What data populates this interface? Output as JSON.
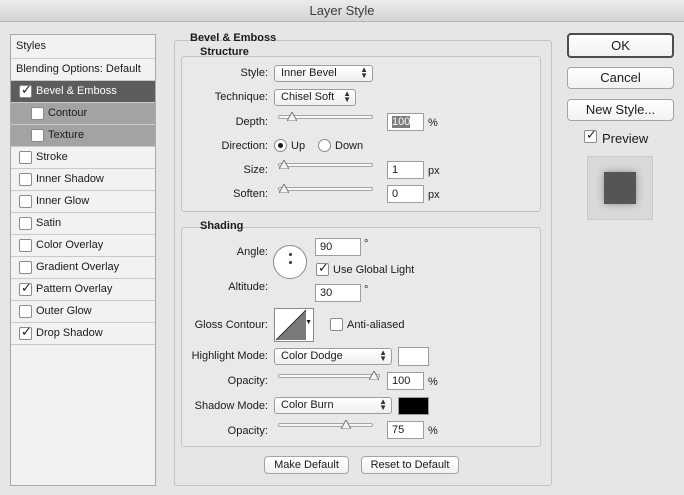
{
  "window": {
    "title": "Layer Style"
  },
  "left_list": {
    "header": "Styles",
    "items": [
      {
        "label": "Blending Options: Default",
        "checkbox": false,
        "checked": false,
        "state": "normal"
      },
      {
        "label": "Bevel & Emboss",
        "checkbox": true,
        "checked": true,
        "state": "selected"
      },
      {
        "label": "Contour",
        "checkbox": true,
        "checked": false,
        "state": "sub"
      },
      {
        "label": "Texture",
        "checkbox": true,
        "checked": false,
        "state": "sub"
      },
      {
        "label": "Stroke",
        "checkbox": true,
        "checked": false,
        "state": "normal"
      },
      {
        "label": "Inner Shadow",
        "checkbox": true,
        "checked": false,
        "state": "normal"
      },
      {
        "label": "Inner Glow",
        "checkbox": true,
        "checked": false,
        "state": "normal"
      },
      {
        "label": "Satin",
        "checkbox": true,
        "checked": false,
        "state": "normal"
      },
      {
        "label": "Color Overlay",
        "checkbox": true,
        "checked": false,
        "state": "normal"
      },
      {
        "label": "Gradient Overlay",
        "checkbox": true,
        "checked": false,
        "state": "normal"
      },
      {
        "label": "Pattern Overlay",
        "checkbox": true,
        "checked": true,
        "state": "normal"
      },
      {
        "label": "Outer Glow",
        "checkbox": true,
        "checked": false,
        "state": "normal"
      },
      {
        "label": "Drop Shadow",
        "checkbox": true,
        "checked": true,
        "state": "normal"
      }
    ]
  },
  "bevel_emboss": {
    "title": "Bevel & Emboss",
    "structure": {
      "title": "Structure",
      "style_label": "Style:",
      "style_value": "Inner Bevel",
      "technique_label": "Technique:",
      "technique_value": "Chisel Soft",
      "depth_label": "Depth:",
      "depth_value": "100",
      "depth_unit": "%",
      "depth_slider_fraction": 0.1,
      "direction_label": "Direction:",
      "direction_up": "Up",
      "direction_down": "Down",
      "direction_selected": "Up",
      "size_label": "Size:",
      "size_value": "1",
      "size_unit": "px",
      "size_slider_fraction": 0.0,
      "soften_label": "Soften:",
      "soften_value": "0",
      "soften_unit": "px",
      "soften_slider_fraction": 0.0
    },
    "shading": {
      "title": "Shading",
      "angle_label": "Angle:",
      "angle_value": "90",
      "angle_unit": "°",
      "use_global_light_label": "Use Global Light",
      "use_global_light_checked": true,
      "altitude_label": "Altitude:",
      "altitude_value": "30",
      "altitude_unit": "°",
      "gloss_contour_label": "Gloss Contour:",
      "anti_aliased_label": "Anti-aliased",
      "anti_aliased_checked": false,
      "highlight_mode_label": "Highlight Mode:",
      "highlight_mode_value": "Color Dodge",
      "highlight_color": "#ffffff",
      "highlight_opacity_label": "Opacity:",
      "highlight_opacity_value": "100",
      "highlight_opacity_unit": "%",
      "highlight_opacity_fraction": 1.0,
      "shadow_mode_label": "Shadow Mode:",
      "shadow_mode_value": "Color Burn",
      "shadow_color": "#000000",
      "shadow_opacity_label": "Opacity:",
      "shadow_opacity_value": "75",
      "shadow_opacity_unit": "%",
      "shadow_opacity_fraction": 0.75
    },
    "make_default_label": "Make Default",
    "reset_default_label": "Reset to Default"
  },
  "right_panel": {
    "ok_label": "OK",
    "cancel_label": "Cancel",
    "new_style_label": "New Style...",
    "preview_label": "Preview",
    "preview_checked": true
  }
}
